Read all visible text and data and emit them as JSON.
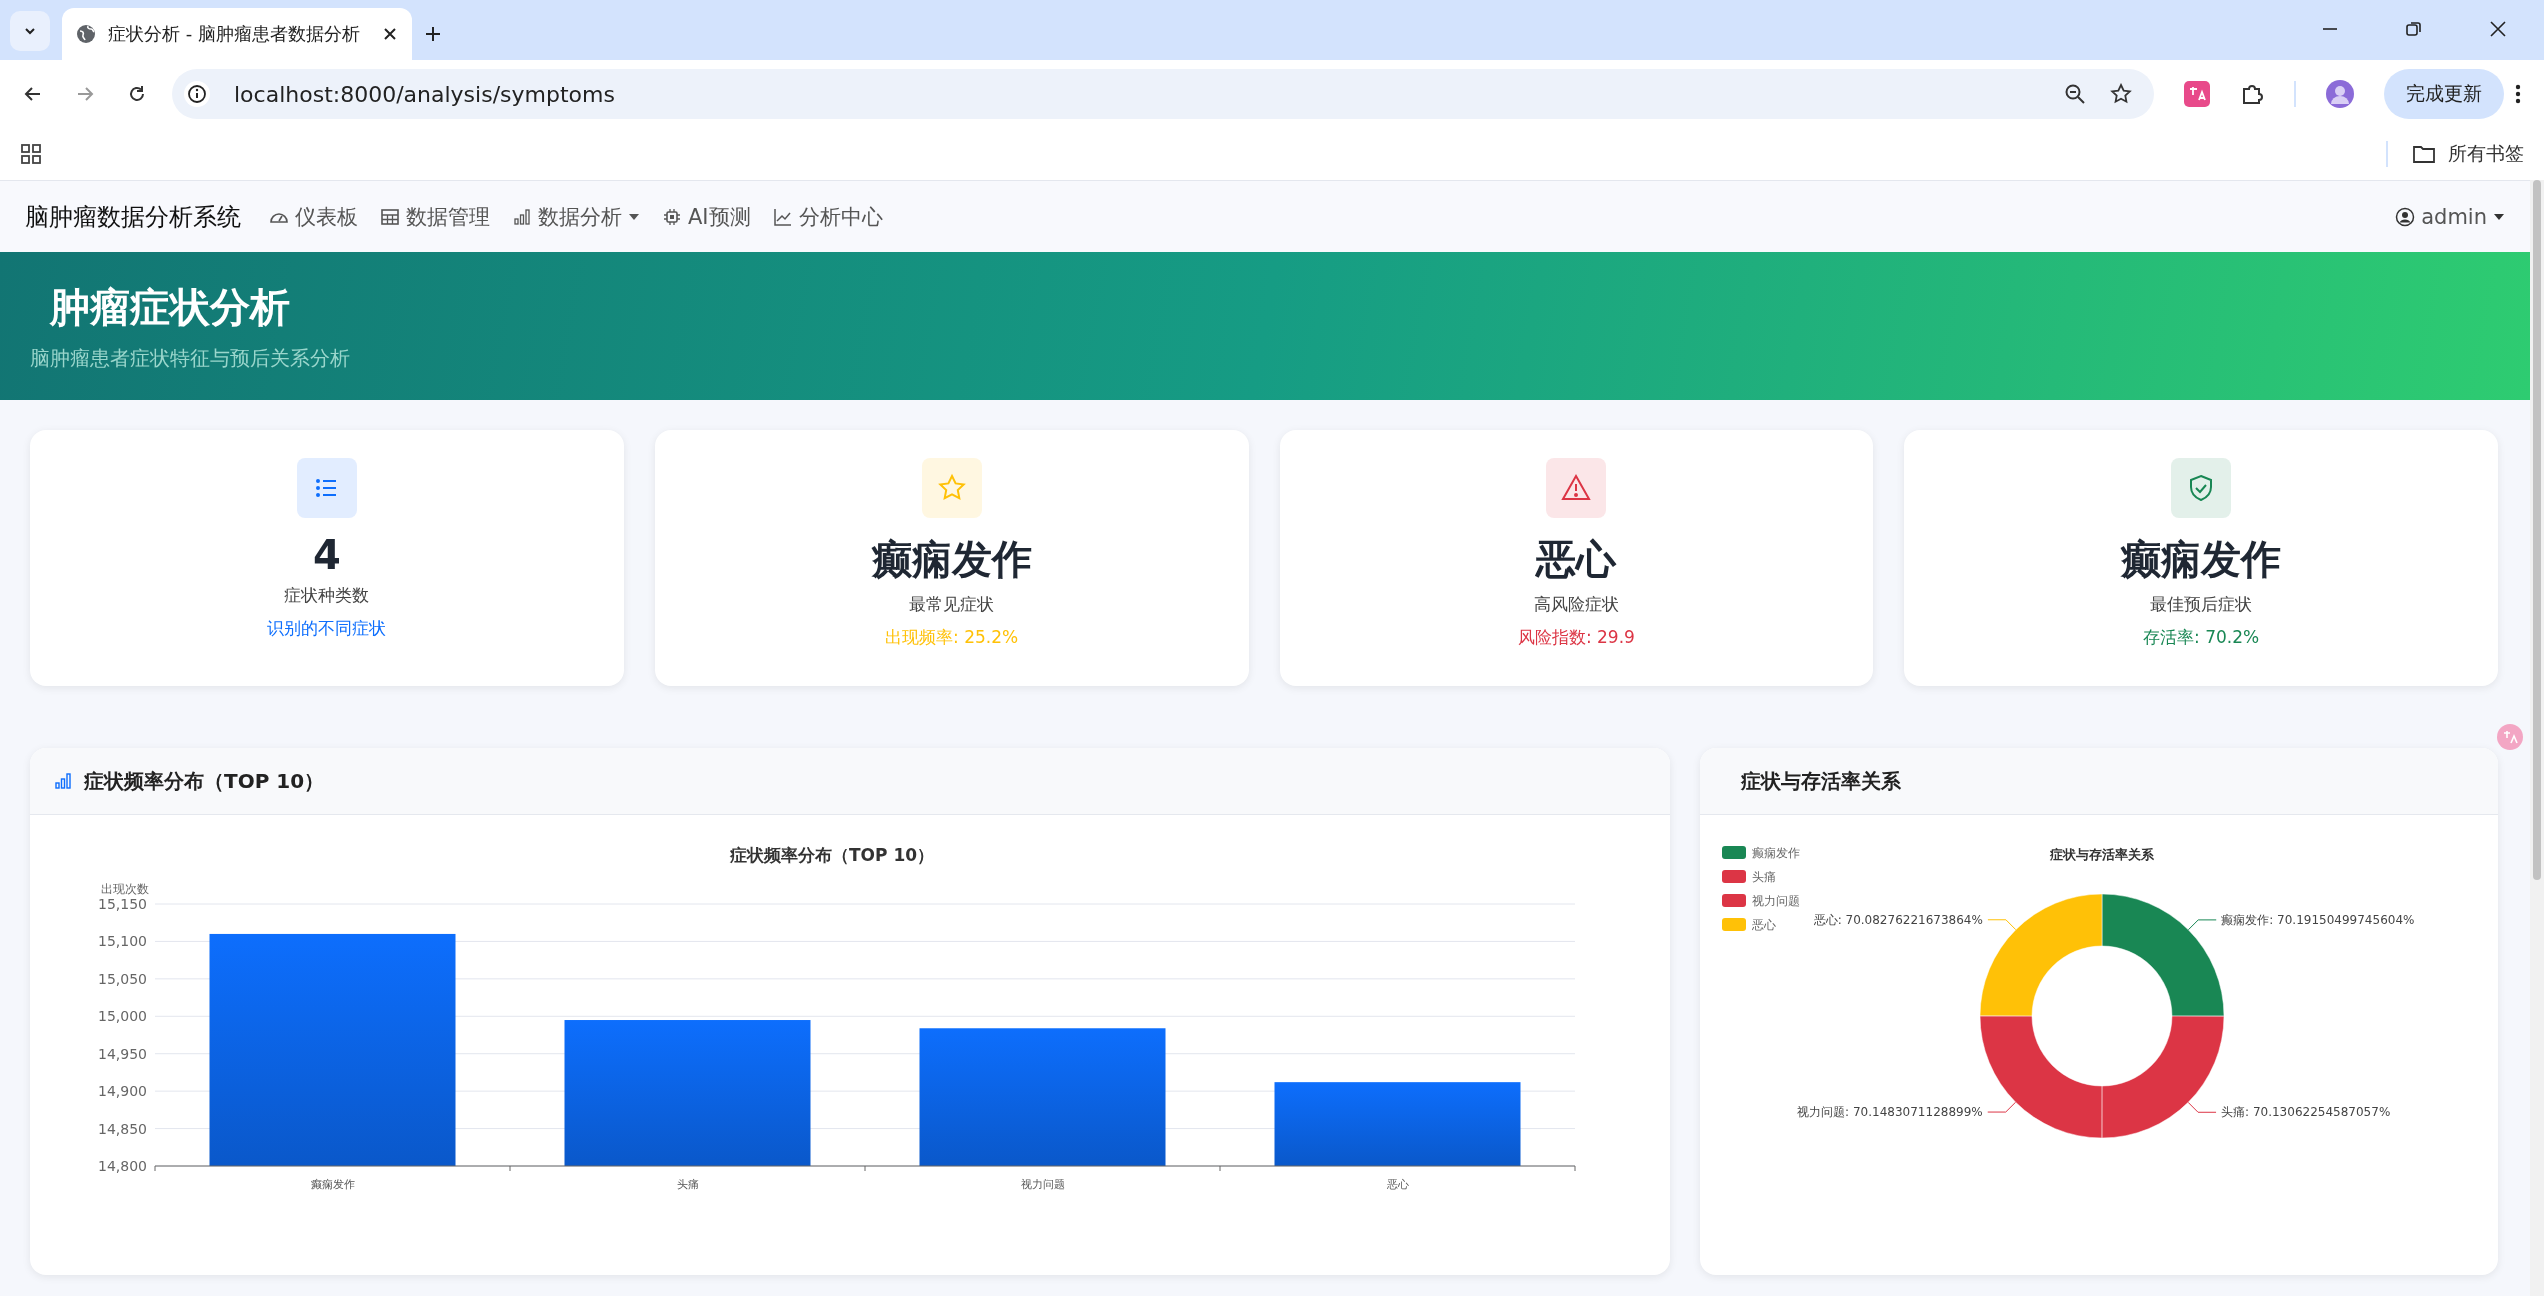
{
  "browser": {
    "tab": {
      "title": "症状分析 - 脑肿瘤患者数据分析",
      "selected": true
    },
    "address": "localhost:8000/analysis/symptoms",
    "update_button": "完成更新",
    "bookmarks_folder": "所有书签"
  },
  "navbar": {
    "brand": "脑肿瘤数据分析系统",
    "items": [
      {
        "label": "仪表板",
        "dropdown": false
      },
      {
        "label": "数据管理",
        "dropdown": false
      },
      {
        "label": "数据分析",
        "dropdown": true
      },
      {
        "label": "AI预测",
        "dropdown": false
      },
      {
        "label": "分析中心",
        "dropdown": false
      }
    ],
    "user": "admin"
  },
  "hero": {
    "title": "肿瘤症状分析",
    "subtitle": "脑肿瘤患者症状特征与预后关系分析"
  },
  "stats": [
    {
      "color": "#0d6efd",
      "value": "4",
      "label": "症状种类数",
      "note": "识别的不同症状"
    },
    {
      "color": "#ffc107",
      "value": "癫痫发作",
      "label": "最常见症状",
      "note": "出现频率: 25.2%"
    },
    {
      "color": "#dc3545",
      "value": "恶心",
      "label": "高风险症状",
      "note": "风险指数: 29.9"
    },
    {
      "color": "#198754",
      "value": "癫痫发作",
      "label": "最佳预后症状",
      "note": "存活率: 70.2%"
    }
  ],
  "frequency_card": {
    "title": "症状频率分布（TOP 10）",
    "chart_data": {
      "type": "bar",
      "title": "症状频率分布（TOP 10）",
      "ylabel": "出现次数",
      "grid": true,
      "categories": [
        "癫痫发作",
        "头痛",
        "视力问题",
        "恶心"
      ],
      "values": [
        15110,
        14995,
        14984,
        14912
      ],
      "ylim": [
        14800,
        15150
      ],
      "yticks": [
        {
          "value": 14800,
          "label": "14,800"
        },
        {
          "value": 14850,
          "label": "14,850"
        },
        {
          "value": 14900,
          "label": "14,900"
        },
        {
          "value": 14950,
          "label": "14,950"
        },
        {
          "value": 15000,
          "label": "15,000"
        },
        {
          "value": 15050,
          "label": "15,050"
        },
        {
          "value": 15100,
          "label": "15,100"
        },
        {
          "value": 15150,
          "label": "15,150"
        }
      ]
    }
  },
  "survival_card": {
    "title": "症状与存活率关系",
    "chart_data": {
      "type": "donut",
      "title": "症状与存活率关系",
      "legend": "top-left",
      "categories": [
        "癫痫发作",
        "头痛",
        "视力问题",
        "恶心"
      ],
      "colors": [
        "#198754",
        "#dc3545",
        "#dc3545",
        "#ffc107"
      ],
      "values": [
        70.19150499745604,
        70.13062254587057,
        70.1483071128899,
        70.08276221673864
      ],
      "value_labels": [
        "癫痫发作: 70.19150499745604%",
        "头痛: 70.13062254587057%",
        "视力问题: 70.1483071128899%",
        "恶心: 70.08276221673864%"
      ]
    }
  }
}
